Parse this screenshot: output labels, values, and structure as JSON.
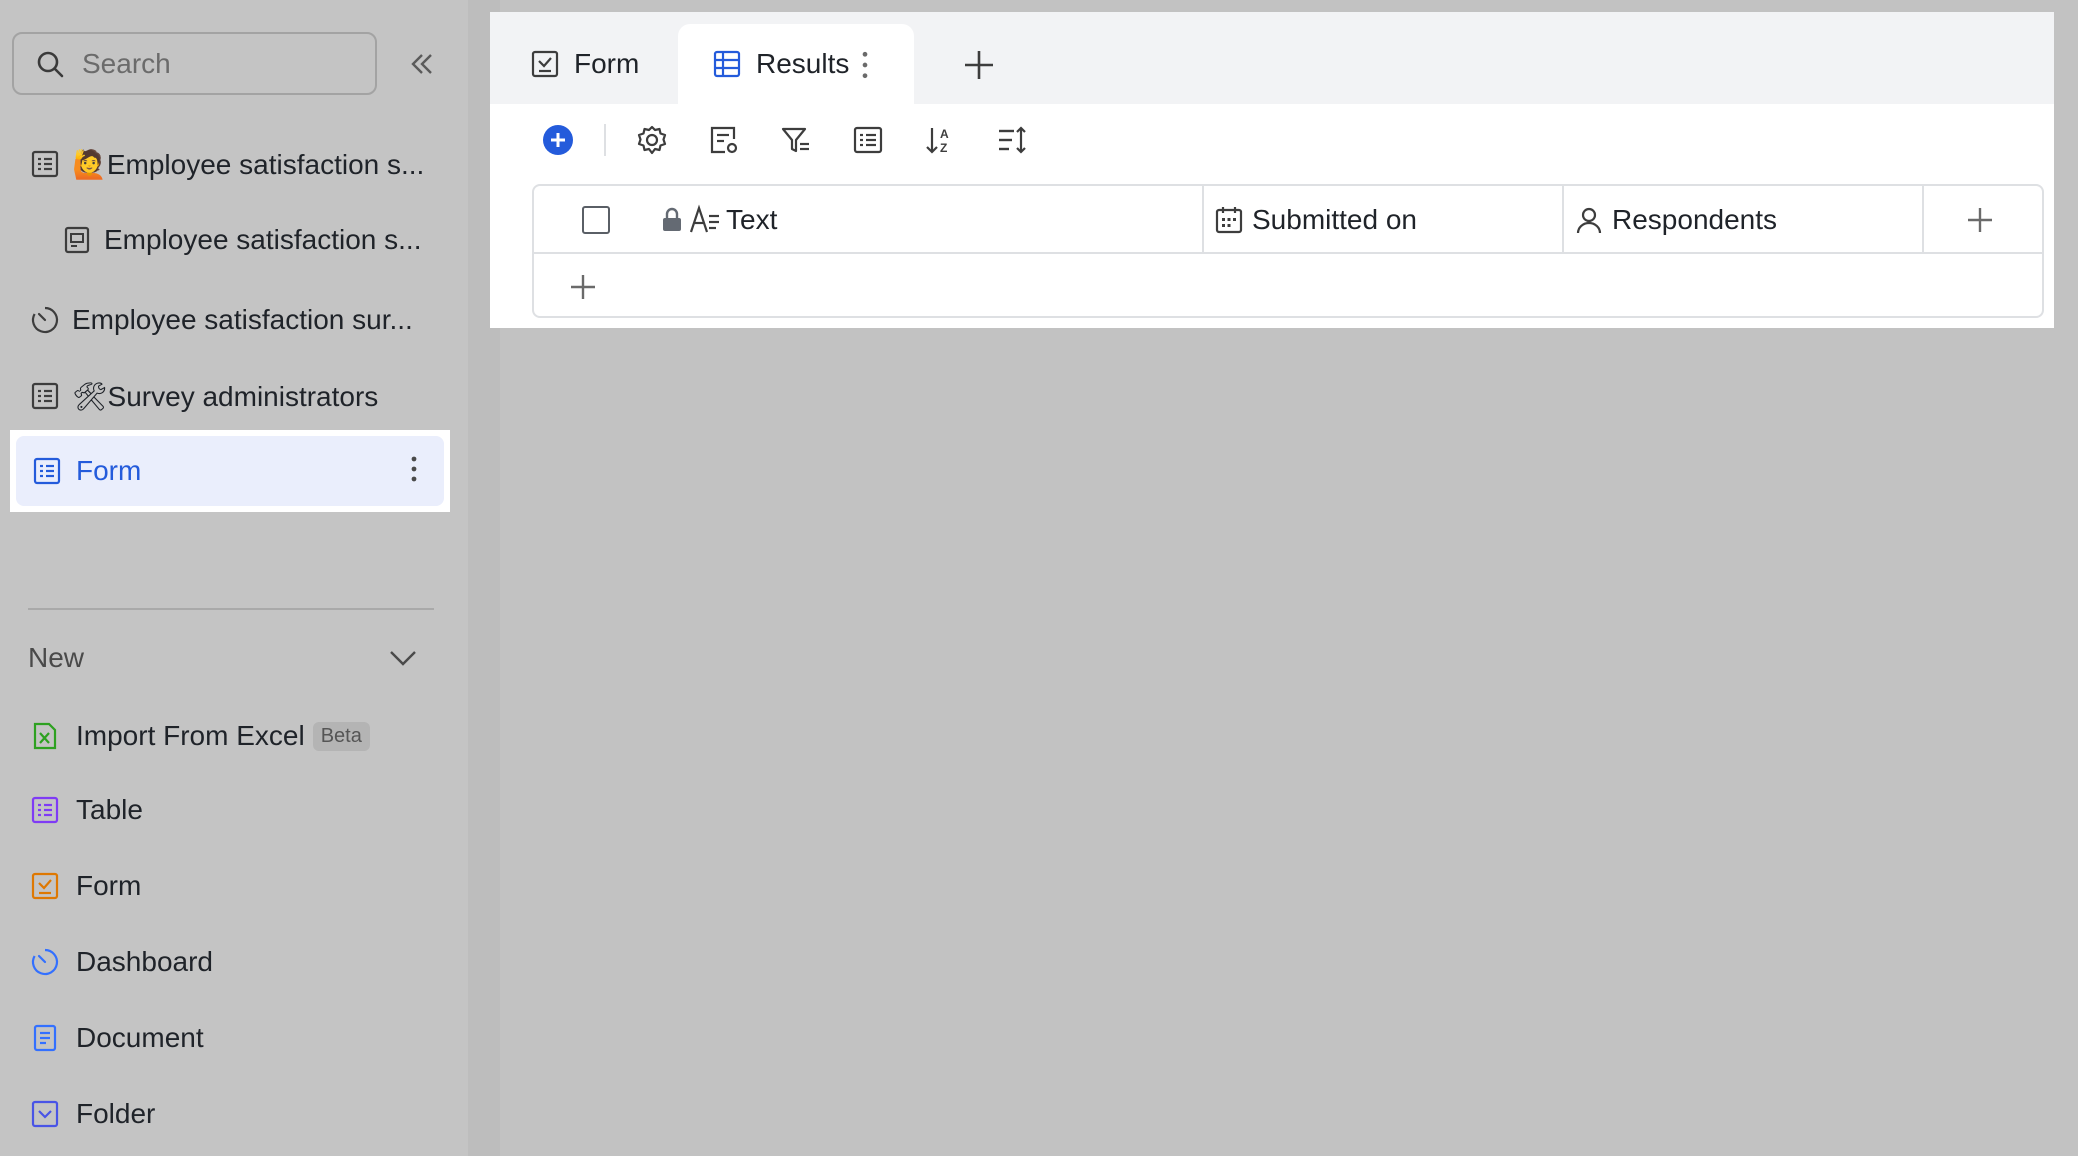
{
  "sidebar": {
    "search_placeholder": "Search",
    "items": [
      {
        "label": "🙋Employee satisfaction s...",
        "icon": "table-icon"
      },
      {
        "label": "Employee satisfaction s...",
        "icon": "form-doc-icon"
      },
      {
        "label": "Employee satisfaction sur...",
        "icon": "dashboard-icon"
      },
      {
        "label": "🛠Survey administrators",
        "icon": "table-icon"
      },
      {
        "label": "Form",
        "icon": "table-icon",
        "active": true
      }
    ],
    "new_section": {
      "label": "New",
      "items": [
        {
          "label": "Import From Excel",
          "badge": "Beta",
          "icon": "excel-icon",
          "color": "#2ea121"
        },
        {
          "label": "Table",
          "icon": "table-icon",
          "color": "#7f3bf5"
        },
        {
          "label": "Form",
          "icon": "form-icon",
          "color": "#de7802"
        },
        {
          "label": "Dashboard",
          "icon": "dashboard-icon",
          "color": "#3370ff"
        },
        {
          "label": "Document",
          "icon": "document-icon",
          "color": "#3370ff"
        },
        {
          "label": "Folder",
          "icon": "folder-icon",
          "color": "#4954e6"
        }
      ]
    }
  },
  "tabs": [
    {
      "label": "Form",
      "icon": "form-check-icon"
    },
    {
      "label": "Results",
      "icon": "grid-table-icon",
      "active": true
    }
  ],
  "toolbar": {
    "icons": [
      "add-record-icon",
      "settings-icon",
      "field-config-icon",
      "filter-icon",
      "group-icon",
      "sort-icon",
      "row-height-icon"
    ]
  },
  "table": {
    "columns": [
      {
        "label": "Text",
        "icon": "text-field-icon",
        "locked": true
      },
      {
        "label": "Submitted on",
        "icon": "calendar-icon"
      },
      {
        "label": "Respondents",
        "icon": "person-icon"
      }
    ]
  },
  "colors": {
    "accent": "#245bdb",
    "active_bg": "#eaeefc",
    "sidebar_bg": "#c4c4c4"
  }
}
